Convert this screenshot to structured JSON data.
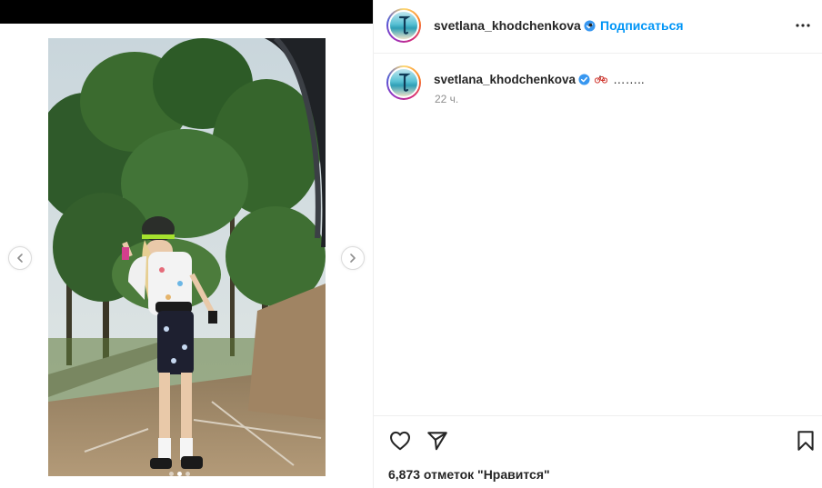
{
  "post": {
    "username": "svetlana_khodchenkova",
    "follow_label": "Подписаться",
    "separator": "•",
    "more_icon": "more-horizontal-icon",
    "caption": {
      "username": "svetlana_khodchenkova",
      "emoji": "bicycle-emoji",
      "text": "……..",
      "time": "22 ч."
    },
    "likes_text": "6,873 отметок \"Нравится\"",
    "carousel": {
      "total_slides": 3,
      "active_slide": 2,
      "prev_icon": "chevron-left-icon",
      "next_icon": "chevron-right-icon"
    }
  },
  "colors": {
    "accent_blue": "#0095f6",
    "text_primary": "#262626",
    "text_secondary": "#8e8e8e",
    "border": "#efefef",
    "verified_blue": "#3897f0"
  }
}
